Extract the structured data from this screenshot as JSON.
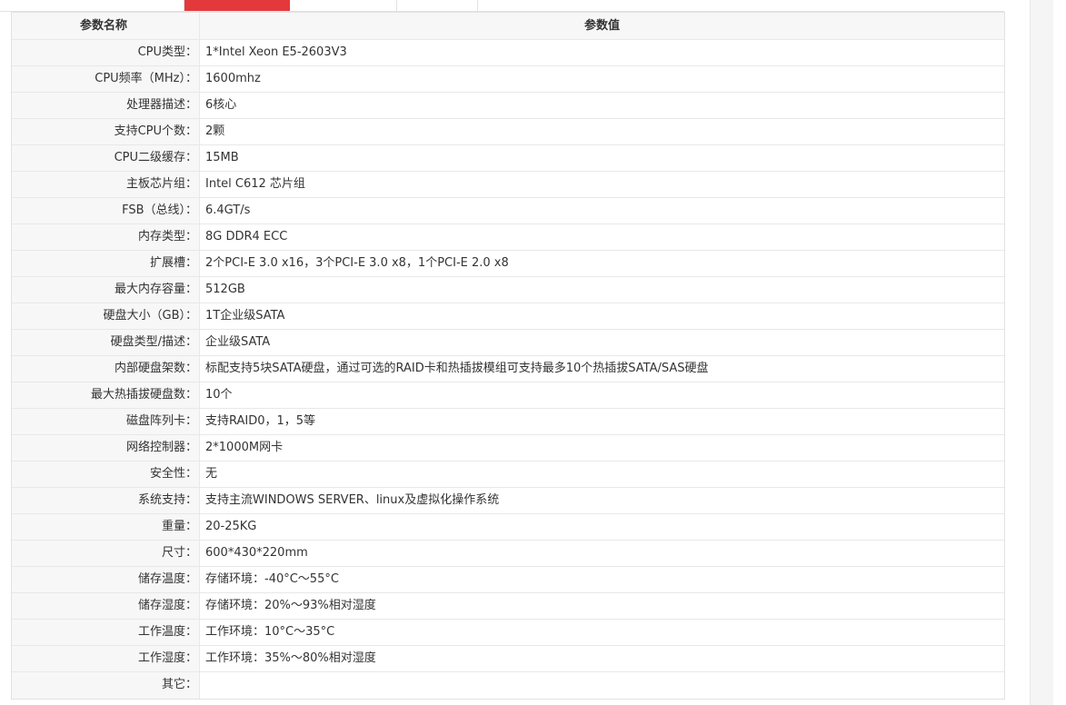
{
  "table": {
    "header": {
      "name": "参数名称",
      "value": "参数值"
    },
    "rows": [
      {
        "name": "CPU类型：",
        "value": "1*Intel Xeon E5-2603V3"
      },
      {
        "name": "CPU频率（MHz）：",
        "value": "1600mhz"
      },
      {
        "name": "处理器描述：",
        "value": "6核心"
      },
      {
        "name": "支持CPU个数：",
        "value": "2颗"
      },
      {
        "name": "CPU二级缓存：",
        "value": "15MB"
      },
      {
        "name": "主板芯片组：",
        "value": "Intel C612 芯片组"
      },
      {
        "name": "FSB（总线）：",
        "value": "6.4GT/s"
      },
      {
        "name": "内存类型：",
        "value": "8G DDR4 ECC"
      },
      {
        "name": "扩展槽：",
        "value": "2个PCI-E 3.0 x16，3个PCI-E 3.0 x8，1个PCI-E 2.0 x8"
      },
      {
        "name": "最大内存容量：",
        "value": "512GB"
      },
      {
        "name": "硬盘大小（GB）：",
        "value": "1T企业级SATA"
      },
      {
        "name": "硬盘类型/描述：",
        "value": "企业级SATA"
      },
      {
        "name": "内部硬盘架数：",
        "value": "标配支持5块SATA硬盘，通过可选的RAID卡和热插拔模组可支持最多10个热插拔SATA/SAS硬盘"
      },
      {
        "name": "最大热插拔硬盘数：",
        "value": "10个"
      },
      {
        "name": "磁盘阵列卡：",
        "value": "支持RAID0，1，5等"
      },
      {
        "name": "网络控制器：",
        "value": "2*1000M网卡"
      },
      {
        "name": "安全性：",
        "value": "无"
      },
      {
        "name": "系统支持：",
        "value": "支持主流WINDOWS SERVER、linux及虚拟化操作系统"
      },
      {
        "name": "重量：",
        "value": "20-25KG"
      },
      {
        "name": "尺寸：",
        "value": "600*430*220mm"
      },
      {
        "name": "储存温度：",
        "value": "存储环境：-40°C～55°C"
      },
      {
        "name": "储存湿度：",
        "value": "存储环境：20%～93%相对湿度"
      },
      {
        "name": "工作温度：",
        "value": "工作环境：10°C～35°C"
      },
      {
        "name": "工作湿度：",
        "value": "工作环境：35%～80%相对湿度"
      },
      {
        "name": "其它：",
        "value": ""
      }
    ]
  },
  "colors": {
    "active_tab": "#e4393c",
    "name_cell_bg": "#f7f7f7",
    "border": "#e2e2e2"
  }
}
